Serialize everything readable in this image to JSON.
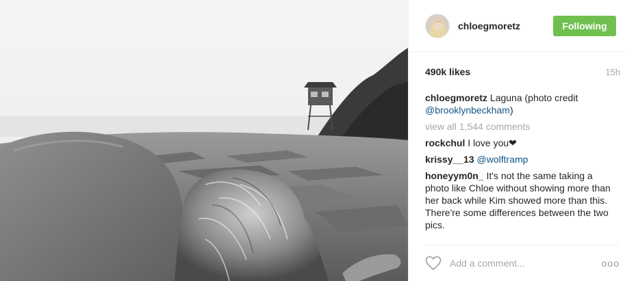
{
  "post": {
    "author": {
      "username": "chloegmoretz",
      "avatar_icon": "profile-photo"
    },
    "follow_button_label": "Following",
    "likes": "490k likes",
    "time_ago": "15h",
    "caption": {
      "username": "chloegmoretz",
      "text": "Laguna (photo credit ",
      "mention": "@brooklynbeckham",
      "text_end": ")"
    },
    "view_all_label": "view all 1,544 comments",
    "comments": [
      {
        "username": "rockchul",
        "text": "I love you❤",
        "mention": ""
      },
      {
        "username": "krissy__13",
        "text": "",
        "mention": "@wolftramp"
      },
      {
        "username": "honeyym0n_",
        "text": "It's not the same taking a photo like Chloe without showing more than her back while Kim showed more than this. There're some differences between the two pics.",
        "mention": ""
      }
    ],
    "add_comment_placeholder": "Add a comment...",
    "more_icon_glyph": "ooo"
  },
  "colors": {
    "follow_green": "#70c050",
    "mention_blue": "#125688",
    "muted_gray": "#a5a7aa"
  }
}
